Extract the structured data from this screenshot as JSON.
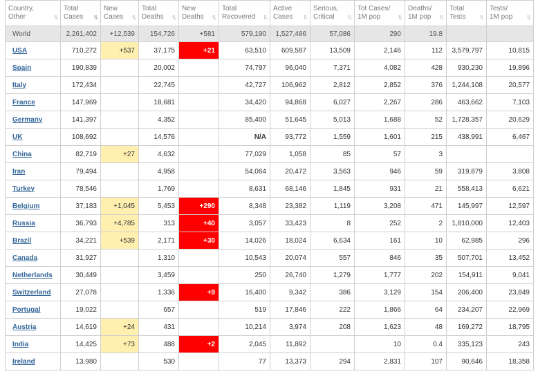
{
  "colors": {
    "new_cases_highlight": "#fff0b0",
    "new_deaths_highlight": "#ff0000",
    "link": "#336699",
    "world_row_bg": "#e6e6e6"
  },
  "columns": [
    {
      "key": "country",
      "line1": "Country,",
      "line2": "Other"
    },
    {
      "key": "total_cases",
      "line1": "Total",
      "line2": "Cases",
      "sorted": true
    },
    {
      "key": "new_cases",
      "line1": "New",
      "line2": "Cases"
    },
    {
      "key": "total_deaths",
      "line1": "Total",
      "line2": "Deaths"
    },
    {
      "key": "new_deaths",
      "line1": "New",
      "line2": "Deaths"
    },
    {
      "key": "recovered",
      "line1": "Total",
      "line2": "Recovered"
    },
    {
      "key": "active",
      "line1": "Active",
      "line2": "Cases"
    },
    {
      "key": "serious",
      "line1": "Serious,",
      "line2": "Critical"
    },
    {
      "key": "cases_per_1m",
      "line1": "Tot Cases/",
      "line2": "1M pop"
    },
    {
      "key": "deaths_per_1m",
      "line1": "Deaths/",
      "line2": "1M pop"
    },
    {
      "key": "total_tests",
      "line1": "Total",
      "line2": "Tests"
    },
    {
      "key": "tests_per_1m",
      "line1": "Tests/",
      "line2": "1M pop"
    }
  ],
  "rows": [
    {
      "country": "World",
      "total_cases": "2,261,402",
      "new_cases": "+12,539",
      "total_deaths": "154,726",
      "new_deaths": "+581",
      "recovered": "579,190",
      "active": "1,527,486",
      "serious": "57,086",
      "cases_per_1m": "290",
      "deaths_per_1m": "19.8",
      "total_tests": "",
      "tests_per_1m": ""
    },
    {
      "country": "USA",
      "total_cases": "710,272",
      "new_cases": "+537",
      "total_deaths": "37,175",
      "new_deaths": "+21",
      "recovered": "63,510",
      "active": "609,587",
      "serious": "13,509",
      "cases_per_1m": "2,146",
      "deaths_per_1m": "112",
      "total_tests": "3,579,797",
      "tests_per_1m": "10,815"
    },
    {
      "country": "Spain",
      "total_cases": "190,839",
      "new_cases": "",
      "total_deaths": "20,002",
      "new_deaths": "",
      "recovered": "74,797",
      "active": "96,040",
      "serious": "7,371",
      "cases_per_1m": "4,082",
      "deaths_per_1m": "428",
      "total_tests": "930,230",
      "tests_per_1m": "19,896"
    },
    {
      "country": "Italy",
      "total_cases": "172,434",
      "new_cases": "",
      "total_deaths": "22,745",
      "new_deaths": "",
      "recovered": "42,727",
      "active": "106,962",
      "serious": "2,812",
      "cases_per_1m": "2,852",
      "deaths_per_1m": "376",
      "total_tests": "1,244,108",
      "tests_per_1m": "20,577"
    },
    {
      "country": "France",
      "total_cases": "147,969",
      "new_cases": "",
      "total_deaths": "18,681",
      "new_deaths": "",
      "recovered": "34,420",
      "active": "94,868",
      "serious": "6,027",
      "cases_per_1m": "2,267",
      "deaths_per_1m": "286",
      "total_tests": "463,662",
      "tests_per_1m": "7,103"
    },
    {
      "country": "Germany",
      "total_cases": "141,397",
      "new_cases": "",
      "total_deaths": "4,352",
      "new_deaths": "",
      "recovered": "85,400",
      "active": "51,645",
      "serious": "5,013",
      "cases_per_1m": "1,688",
      "deaths_per_1m": "52",
      "total_tests": "1,728,357",
      "tests_per_1m": "20,629"
    },
    {
      "country": "UK",
      "total_cases": "108,692",
      "new_cases": "",
      "total_deaths": "14,576",
      "new_deaths": "",
      "recovered": "N/A",
      "active": "93,772",
      "serious": "1,559",
      "cases_per_1m": "1,601",
      "deaths_per_1m": "215",
      "total_tests": "438,991",
      "tests_per_1m": "6,467"
    },
    {
      "country": "China",
      "total_cases": "82,719",
      "new_cases": "+27",
      "total_deaths": "4,632",
      "new_deaths": "",
      "recovered": "77,029",
      "active": "1,058",
      "serious": "85",
      "cases_per_1m": "57",
      "deaths_per_1m": "3",
      "total_tests": "",
      "tests_per_1m": ""
    },
    {
      "country": "Iran",
      "total_cases": "79,494",
      "new_cases": "",
      "total_deaths": "4,958",
      "new_deaths": "",
      "recovered": "54,064",
      "active": "20,472",
      "serious": "3,563",
      "cases_per_1m": "946",
      "deaths_per_1m": "59",
      "total_tests": "319,879",
      "tests_per_1m": "3,808"
    },
    {
      "country": "Turkey",
      "total_cases": "78,546",
      "new_cases": "",
      "total_deaths": "1,769",
      "new_deaths": "",
      "recovered": "8,631",
      "active": "68,146",
      "serious": "1,845",
      "cases_per_1m": "931",
      "deaths_per_1m": "21",
      "total_tests": "558,413",
      "tests_per_1m": "6,621"
    },
    {
      "country": "Belgium",
      "total_cases": "37,183",
      "new_cases": "+1,045",
      "total_deaths": "5,453",
      "new_deaths": "+290",
      "recovered": "8,348",
      "active": "23,382",
      "serious": "1,119",
      "cases_per_1m": "3,208",
      "deaths_per_1m": "471",
      "total_tests": "145,997",
      "tests_per_1m": "12,597"
    },
    {
      "country": "Russia",
      "total_cases": "36,793",
      "new_cases": "+4,785",
      "total_deaths": "313",
      "new_deaths": "+40",
      "recovered": "3,057",
      "active": "33,423",
      "serious": "8",
      "cases_per_1m": "252",
      "deaths_per_1m": "2",
      "total_tests": "1,810,000",
      "tests_per_1m": "12,403"
    },
    {
      "country": "Brazil",
      "total_cases": "34,221",
      "new_cases": "+539",
      "total_deaths": "2,171",
      "new_deaths": "+30",
      "recovered": "14,026",
      "active": "18,024",
      "serious": "6,634",
      "cases_per_1m": "161",
      "deaths_per_1m": "10",
      "total_tests": "62,985",
      "tests_per_1m": "296"
    },
    {
      "country": "Canada",
      "total_cases": "31,927",
      "new_cases": "",
      "total_deaths": "1,310",
      "new_deaths": "",
      "recovered": "10,543",
      "active": "20,074",
      "serious": "557",
      "cases_per_1m": "846",
      "deaths_per_1m": "35",
      "total_tests": "507,701",
      "tests_per_1m": "13,452"
    },
    {
      "country": "Netherlands",
      "total_cases": "30,449",
      "new_cases": "",
      "total_deaths": "3,459",
      "new_deaths": "",
      "recovered": "250",
      "active": "26,740",
      "serious": "1,279",
      "cases_per_1m": "1,777",
      "deaths_per_1m": "202",
      "total_tests": "154,911",
      "tests_per_1m": "9,041"
    },
    {
      "country": "Switzerland",
      "total_cases": "27,078",
      "new_cases": "",
      "total_deaths": "1,336",
      "new_deaths": "+9",
      "recovered": "16,400",
      "active": "9,342",
      "serious": "386",
      "cases_per_1m": "3,129",
      "deaths_per_1m": "154",
      "total_tests": "206,400",
      "tests_per_1m": "23,849"
    },
    {
      "country": "Portugal",
      "total_cases": "19,022",
      "new_cases": "",
      "total_deaths": "657",
      "new_deaths": "",
      "recovered": "519",
      "active": "17,846",
      "serious": "222",
      "cases_per_1m": "1,866",
      "deaths_per_1m": "64",
      "total_tests": "234,207",
      "tests_per_1m": "22,969"
    },
    {
      "country": "Austria",
      "total_cases": "14,619",
      "new_cases": "+24",
      "total_deaths": "431",
      "new_deaths": "",
      "recovered": "10,214",
      "active": "3,974",
      "serious": "208",
      "cases_per_1m": "1,623",
      "deaths_per_1m": "48",
      "total_tests": "169,272",
      "tests_per_1m": "18,795"
    },
    {
      "country": "India",
      "total_cases": "14,425",
      "new_cases": "+73",
      "total_deaths": "488",
      "new_deaths": "+2",
      "recovered": "2,045",
      "active": "11,892",
      "serious": "",
      "cases_per_1m": "10",
      "deaths_per_1m": "0.4",
      "total_tests": "335,123",
      "tests_per_1m": "243"
    },
    {
      "country": "Ireland",
      "total_cases": "13,980",
      "new_cases": "",
      "total_deaths": "530",
      "new_deaths": "",
      "recovered": "77",
      "active": "13,373",
      "serious": "294",
      "cases_per_1m": "2,831",
      "deaths_per_1m": "107",
      "total_tests": "90,646",
      "tests_per_1m": "18,358"
    }
  ]
}
